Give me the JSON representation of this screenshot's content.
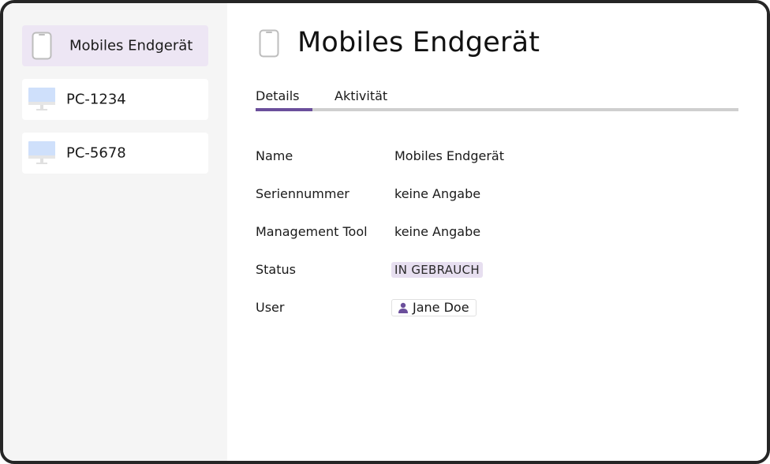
{
  "sidebar": {
    "items": [
      {
        "label": "Mobiles Endgerät",
        "icon": "smartphone-icon",
        "selected": true
      },
      {
        "label": "PC-1234",
        "icon": "monitor-icon",
        "selected": false
      },
      {
        "label": "PC-5678",
        "icon": "monitor-icon",
        "selected": false
      }
    ]
  },
  "header": {
    "title": "Mobiles Endgerät",
    "icon": "smartphone-icon"
  },
  "tabs": [
    {
      "label": "Details",
      "active": true
    },
    {
      "label": "Aktivität",
      "active": false
    }
  ],
  "details": {
    "name_label": "Name",
    "name_value": "Mobiles Endgerät",
    "serial_label": "Seriennummer",
    "serial_value": "keine Angabe",
    "mgmt_label": "Management Tool",
    "mgmt_value": "keine Angabe",
    "status_label": "Status",
    "status_value": "IN GEBRAUCH",
    "user_label": "User",
    "user_value": "Jane Doe"
  },
  "colors": {
    "accent": "#6b4f9b",
    "selected_bg": "#ede6f4",
    "badge_bg": "#e7dff0",
    "monitor": "#cfe0fb",
    "sidebar_bg": "#f5f5f5"
  }
}
